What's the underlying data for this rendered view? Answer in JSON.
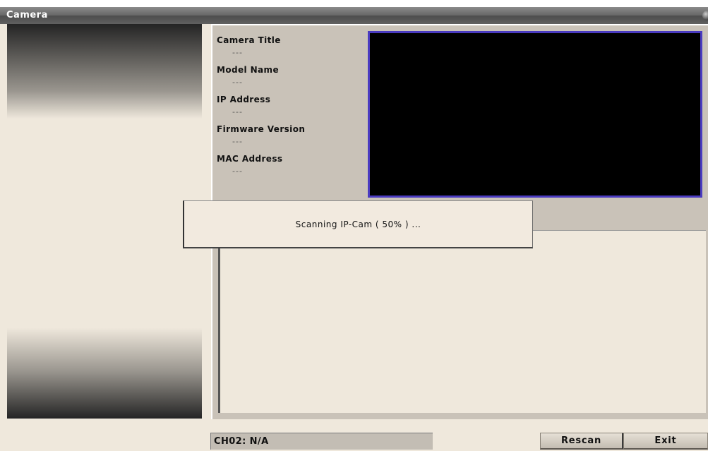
{
  "window": {
    "title": "Camera"
  },
  "camera_info": {
    "fields": [
      {
        "label": "Camera Title",
        "value": "---"
      },
      {
        "label": "Model Name",
        "value": "---"
      },
      {
        "label": "IP Address",
        "value": "---"
      },
      {
        "label": "Firmware Version",
        "value": "---"
      },
      {
        "label": "MAC Address",
        "value": "---"
      }
    ]
  },
  "scan": {
    "message": "Scanning IP-Cam ( 50% ) ...",
    "progress_percent": 50
  },
  "status": {
    "channel": "CH02: N/A"
  },
  "buttons": {
    "rescan": "Rescan",
    "exit": "Exit"
  },
  "colors": {
    "preview_border": "#4a3bc0",
    "preview_bg": "#000000",
    "panel_bg": "#efe8dc"
  }
}
